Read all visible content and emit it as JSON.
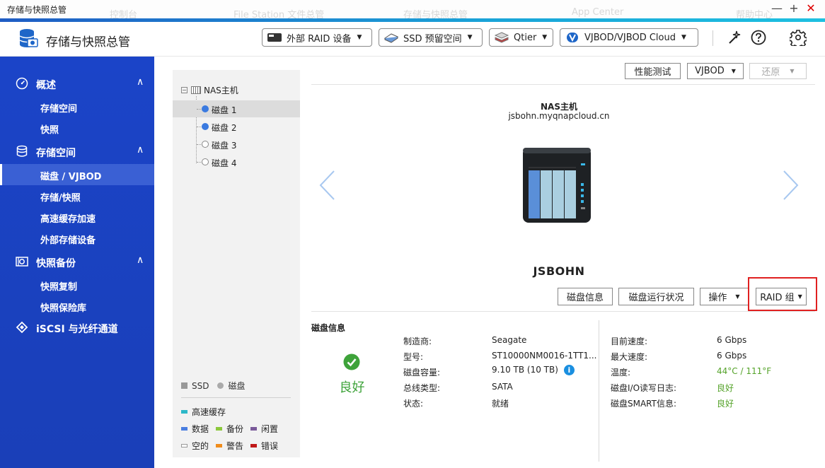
{
  "window": {
    "title": "存储与快照总管",
    "ghost_tabs": [
      "控制台",
      "File Station 文件总管",
      "存储与快照总管",
      "App Center",
      "帮助中心"
    ],
    "minimize": "—",
    "maximize": "+",
    "close": "✕"
  },
  "header": {
    "app_name": "存储与快照总管",
    "buttons": {
      "raid": "外部 RAID 设备",
      "ssd": "SSD 预留空间",
      "qtier": "Qtier",
      "vjbod": "VJBOD/VJBOD Cloud"
    }
  },
  "sidebar": {
    "sections": [
      {
        "label": "概述",
        "chevron": "∧",
        "icon": "gauge-icon"
      },
      {
        "label": "存储空间",
        "chevron": "∧",
        "icon": "database-icon"
      },
      {
        "label": "快照备份",
        "chevron": "∧",
        "icon": "snapshot-icon"
      },
      {
        "label": "iSCSI 与光纤通道",
        "icon": "iscsi-icon"
      }
    ],
    "items": [
      {
        "label": "存储空间"
      },
      {
        "label": "快照"
      },
      {
        "label": "磁盘 / VJBOD"
      },
      {
        "label": "存储/快照"
      },
      {
        "label": "高速缓存加速"
      },
      {
        "label": "外部存储设备"
      },
      {
        "label": "快照复制"
      },
      {
        "label": "快照保险库"
      }
    ]
  },
  "tree": {
    "root": "NAS主机",
    "root_toggle": "−",
    "disks": [
      {
        "label": "磁盘 1",
        "state": "filled"
      },
      {
        "label": "磁盘 2",
        "state": "filled"
      },
      {
        "label": "磁盘 3",
        "state": "empty"
      },
      {
        "label": "磁盘 4",
        "state": "empty"
      }
    ]
  },
  "legend": {
    "ssd": "SSD",
    "disk": "磁盘",
    "cache": "高速缓存",
    "data": "数据",
    "backup": "备份",
    "idle": "闲置",
    "empty": "空的",
    "warning": "警告",
    "error": "错误",
    "colors": {
      "cache": "#2cb8c8",
      "data": "#4a7ee0",
      "backup": "#8cc83c",
      "idle": "#7a5a9a",
      "empty": "#ffffff",
      "warning": "#f08c1c",
      "error": "#c01818"
    }
  },
  "toolbar": {
    "perf_test": "性能测试",
    "vjbod": "VJBOD",
    "restore": "还原"
  },
  "device": {
    "nas_name": "NAS主机",
    "host": "jsbohn.myqnapcloud.cn",
    "name": "JSBOHN"
  },
  "actions": {
    "disk_info": "磁盘信息",
    "disk_health": "磁盘运行状况",
    "operate": "操作",
    "raid_group": "RAID 组"
  },
  "disk_info": {
    "title": "磁盘信息",
    "status": "良好",
    "left": [
      {
        "label": "制造商:",
        "value": "Seagate"
      },
      {
        "label": "型号:",
        "value": "ST10000NM0016-1TT1..."
      },
      {
        "label": "磁盘容量:",
        "value": "9.10 TB (10 TB)"
      },
      {
        "label": "总线类型:",
        "value": "SATA"
      },
      {
        "label": "状态:",
        "value": "就绪"
      }
    ],
    "right": [
      {
        "label": "目前速度:",
        "value": "6 Gbps"
      },
      {
        "label": "最大速度:",
        "value": "6 Gbps"
      },
      {
        "label": "温度:",
        "value": "44°C / 111°F"
      },
      {
        "label": "磁盘I/O读写日志:",
        "value": "良好"
      },
      {
        "label": "磁盘SMART信息:",
        "value": "良好"
      }
    ]
  }
}
